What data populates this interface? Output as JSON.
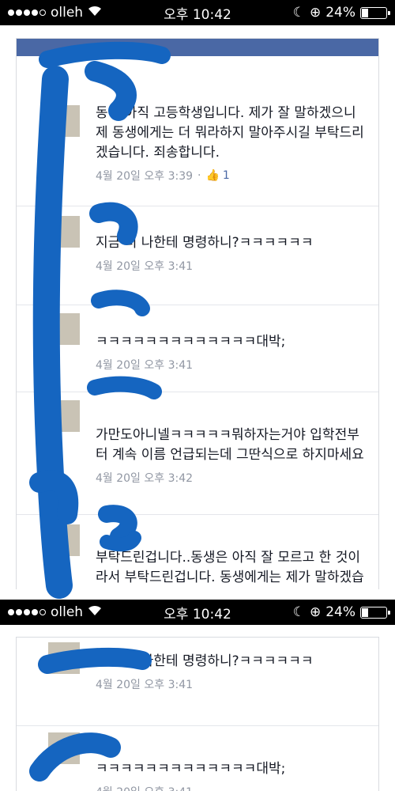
{
  "status": {
    "carrier": "olleh",
    "time": "오후 10:42",
    "battery": "24%",
    "battery_level": 0.24
  },
  "colors": {
    "redaction": "#1565c0",
    "facebook_blue": "#4a68a5"
  },
  "shot1": {
    "comments": [
      {
        "text": "동생 아직 고등학생입니다. 제가 잘 말하겠으니 제 동생에게는 더 뭐라하지 말아주시길 부탁드리겠습니다. 죄송합니다.",
        "time": "4월 20일 오후 3:39",
        "likes": "1"
      },
      {
        "text": "지금 너 나한테 명령하니?ㅋㅋㅋㅋㅋㅋ",
        "time": "4월 20일 오후 3:41"
      },
      {
        "text": "ㅋㅋㅋㅋㅋㅋㅋㅋㅋㅋㅋㅋㅋ대박;",
        "time": "4월 20일 오후 3:41"
      },
      {
        "text": "가만도아니넬ㅋㅋㅋㅋㅋ뭐하자는거야 입학전부터 계속 이름 언급되는데 그딴식으로 하지마세요",
        "time": "4월 20일 오후 3:42"
      },
      {
        "text": "부탁드린겁니다..동생은 아직 잘 모르고 한 것이라서 부탁드린겁니다. 동생에게는 제가 말하겠습니다. 죄송합니"
      }
    ]
  },
  "shot2": {
    "comments": [
      {
        "text": "지금 너 나한테 명령하니?ㅋㅋㅋㅋㅋㅋ",
        "time": "4월 20일 오후 3:41"
      },
      {
        "text": "ㅋㅋㅋㅋㅋㅋㅋㅋㅋㅋㅋㅋㅋ대박;",
        "time": "4월 20일 오후 3:41"
      }
    ]
  }
}
